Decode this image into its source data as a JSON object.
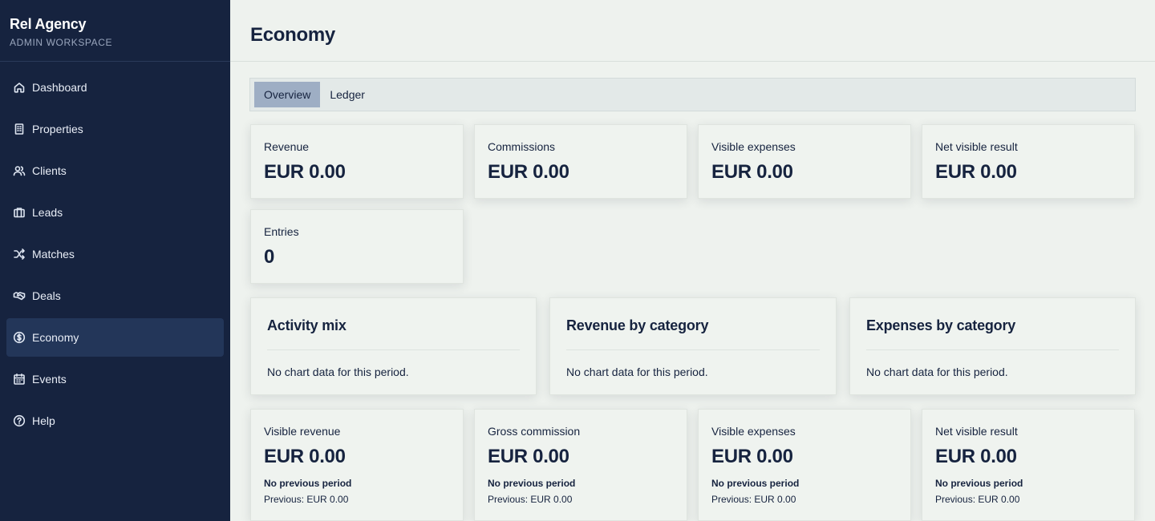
{
  "sidebar": {
    "brand": "Rel Agency",
    "subtitle": "ADMIN WORKSPACE",
    "items": [
      {
        "label": "Dashboard",
        "icon": "home-icon"
      },
      {
        "label": "Properties",
        "icon": "building-icon"
      },
      {
        "label": "Clients",
        "icon": "users-icon"
      },
      {
        "label": "Leads",
        "icon": "briefcase-icon"
      },
      {
        "label": "Matches",
        "icon": "shuffle-icon"
      },
      {
        "label": "Deals",
        "icon": "handshake-icon"
      },
      {
        "label": "Economy",
        "icon": "dollar-circle-icon",
        "active": true
      },
      {
        "label": "Events",
        "icon": "calendar-icon"
      },
      {
        "label": "Help",
        "icon": "help-circle-icon"
      }
    ]
  },
  "header": {
    "title": "Economy"
  },
  "tabs": [
    {
      "label": "Overview",
      "active": true
    },
    {
      "label": "Ledger"
    }
  ],
  "kpis": [
    {
      "label": "Revenue",
      "value": "EUR 0.00"
    },
    {
      "label": "Commissions",
      "value": "EUR 0.00"
    },
    {
      "label": "Visible expenses",
      "value": "EUR 0.00"
    },
    {
      "label": "Net visible result",
      "value": "EUR 0.00"
    },
    {
      "label": "Entries",
      "value": "0"
    }
  ],
  "charts": [
    {
      "title": "Activity mix",
      "empty": "No chart data for this period."
    },
    {
      "title": "Revenue by category",
      "empty": "No chart data for this period."
    },
    {
      "title": "Expenses by category",
      "empty": "No chart data for this period."
    }
  ],
  "comparisons": [
    {
      "label": "Visible revenue",
      "value": "EUR 0.00",
      "status": "No previous period",
      "previous": "Previous: EUR 0.00"
    },
    {
      "label": "Gross commission",
      "value": "EUR 0.00",
      "status": "No previous period",
      "previous": "Previous: EUR 0.00"
    },
    {
      "label": "Visible expenses",
      "value": "EUR 0.00",
      "status": "No previous period",
      "previous": "Previous: EUR 0.00"
    },
    {
      "label": "Net visible result",
      "value": "EUR 0.00",
      "status": "No previous period",
      "previous": "Previous: EUR 0.00"
    }
  ],
  "colors": {
    "sidebar": "#16233f",
    "active_nav": "#233659",
    "active_tab": "#9eaec4",
    "background": "#eef2ee"
  }
}
